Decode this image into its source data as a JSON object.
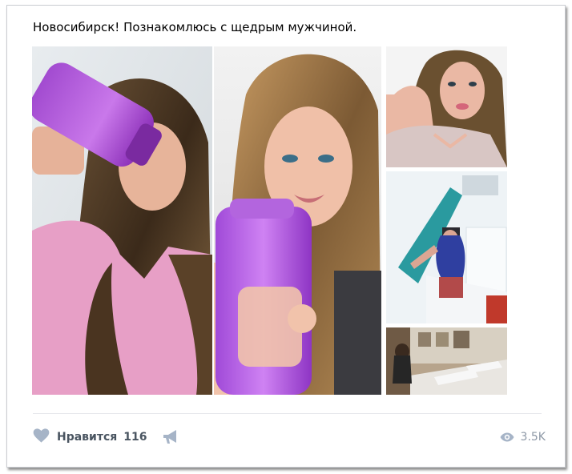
{
  "post": {
    "text": "Новосибирск! Познакомлюсь с щедрым мужчиной.",
    "photos": [
      "photo-drinking-from-shaker",
      "photo-selfie-with-shaker",
      "photo-selfie-closeup",
      "photo-mirror-selfie-bathroom",
      "photo-mirror-selfie-sinks"
    ]
  },
  "actions": {
    "like_label": "Нравится",
    "like_count": "116",
    "like_icon": "heart-icon",
    "share_icon": "megaphone-icon",
    "views_icon": "eye-icon",
    "views_count": "3.5K"
  },
  "colors": {
    "text": "#000000",
    "action_text": "#4a5561",
    "icon": "#a6b4c7",
    "muted": "#8d98a6",
    "border": "#c9ccd1"
  }
}
